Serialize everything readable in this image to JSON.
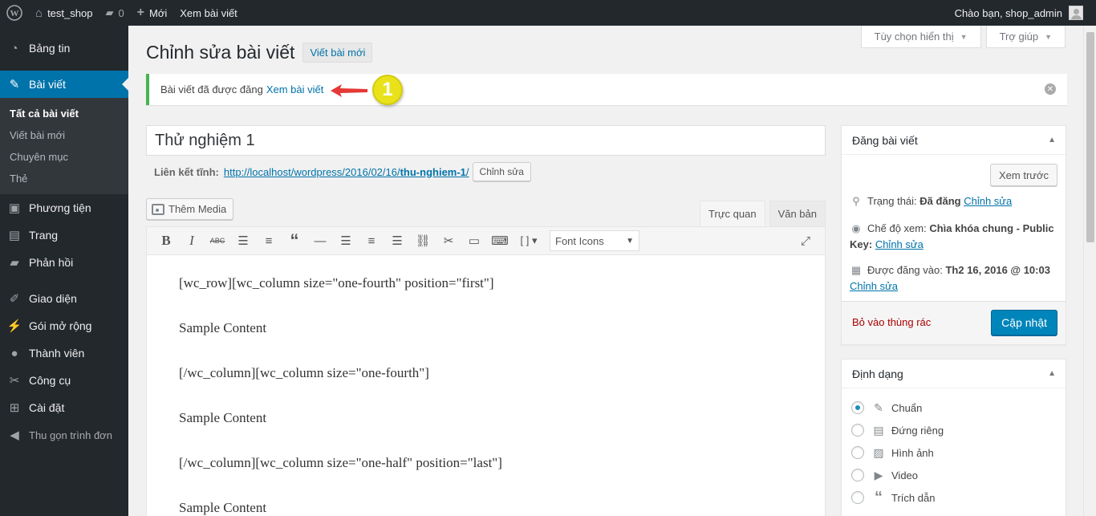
{
  "adminbar": {
    "site_name": "test_shop",
    "comments_count": "0",
    "new_label": "Mới",
    "view_post": "Xem bài viết",
    "greeting": "Chào bạn, shop_admin"
  },
  "sidebar": {
    "items": [
      {
        "label": "Bảng tin",
        "icon": "dashboard-icon"
      },
      {
        "label": "Bài viết",
        "icon": "pin-icon"
      },
      {
        "label": "Phương tiện",
        "icon": "media-icon"
      },
      {
        "label": "Trang",
        "icon": "page-icon"
      },
      {
        "label": "Phản hồi",
        "icon": "comment-icon"
      },
      {
        "label": "Giao diện",
        "icon": "brush-icon"
      },
      {
        "label": "Gói mở rộng",
        "icon": "plugin-icon"
      },
      {
        "label": "Thành viên",
        "icon": "user-icon"
      },
      {
        "label": "Công cụ",
        "icon": "wrench-icon"
      },
      {
        "label": "Cài đặt",
        "icon": "settings-icon"
      }
    ],
    "submenu": [
      "Tất cả bài viết",
      "Viết bài mới",
      "Chuyên mục",
      "Thẻ"
    ],
    "collapse": "Thu gọn trình đơn"
  },
  "screen_tabs": {
    "options": "Tùy chọn hiển thị",
    "help": "Trợ giúp"
  },
  "page": {
    "title": "Chỉnh sửa bài viết",
    "add_new": "Viết bài mới"
  },
  "notice": {
    "text": "Bài viết đã được đăng",
    "link": "Xem bài viết",
    "annotation": "1"
  },
  "post": {
    "title": "Thử nghiệm 1",
    "permalink_label": "Liên kết tĩnh:",
    "permalink_base": "http://localhost/wordpress/2016/02/16/",
    "permalink_slug": "thu-nghiem-1",
    "permalink_end": "/",
    "edit_slug": "Chỉnh sửa"
  },
  "editor": {
    "add_media": "Thêm Media",
    "tab_visual": "Trực quan",
    "tab_text": "Văn bản",
    "font_select": "Font Icons",
    "content": [
      "[wc_row][wc_column size=\"one-fourth\" position=\"first\"]",
      "Sample Content",
      "[/wc_column][wc_column size=\"one-fourth\"]",
      "Sample Content",
      "[/wc_column][wc_column size=\"one-half\" position=\"last\"]",
      "Sample Content"
    ]
  },
  "publish": {
    "heading": "Đăng bài viết",
    "preview": "Xem trước",
    "status_label": "Trạng thái:",
    "status_value": "Đã đăng",
    "status_edit": "Chỉnh sửa",
    "visibility_label": "Chế độ xem:",
    "visibility_value": "Chìa khóa chung - Public Key:",
    "visibility_edit": "Chỉnh sửa",
    "published_label": "Được đăng vào:",
    "published_value": "Th2 16, 2016 @ 10:03",
    "published_edit": "Chỉnh sửa",
    "trash": "Bỏ vào thùng rác",
    "update": "Cập nhật"
  },
  "format": {
    "heading": "Định dạng",
    "options": [
      "Chuẩn",
      "Đứng riêng",
      "Hình ảnh",
      "Video",
      "Trích dẫn"
    ],
    "selected": "Chuẩn"
  },
  "colors": {
    "admin_dark": "#23282d",
    "accent": "#0073aa",
    "primary_button": "#0085ba",
    "notice_success": "#46b450",
    "annotation": "#e9e21b",
    "annotation_arrow": "#e53935"
  }
}
